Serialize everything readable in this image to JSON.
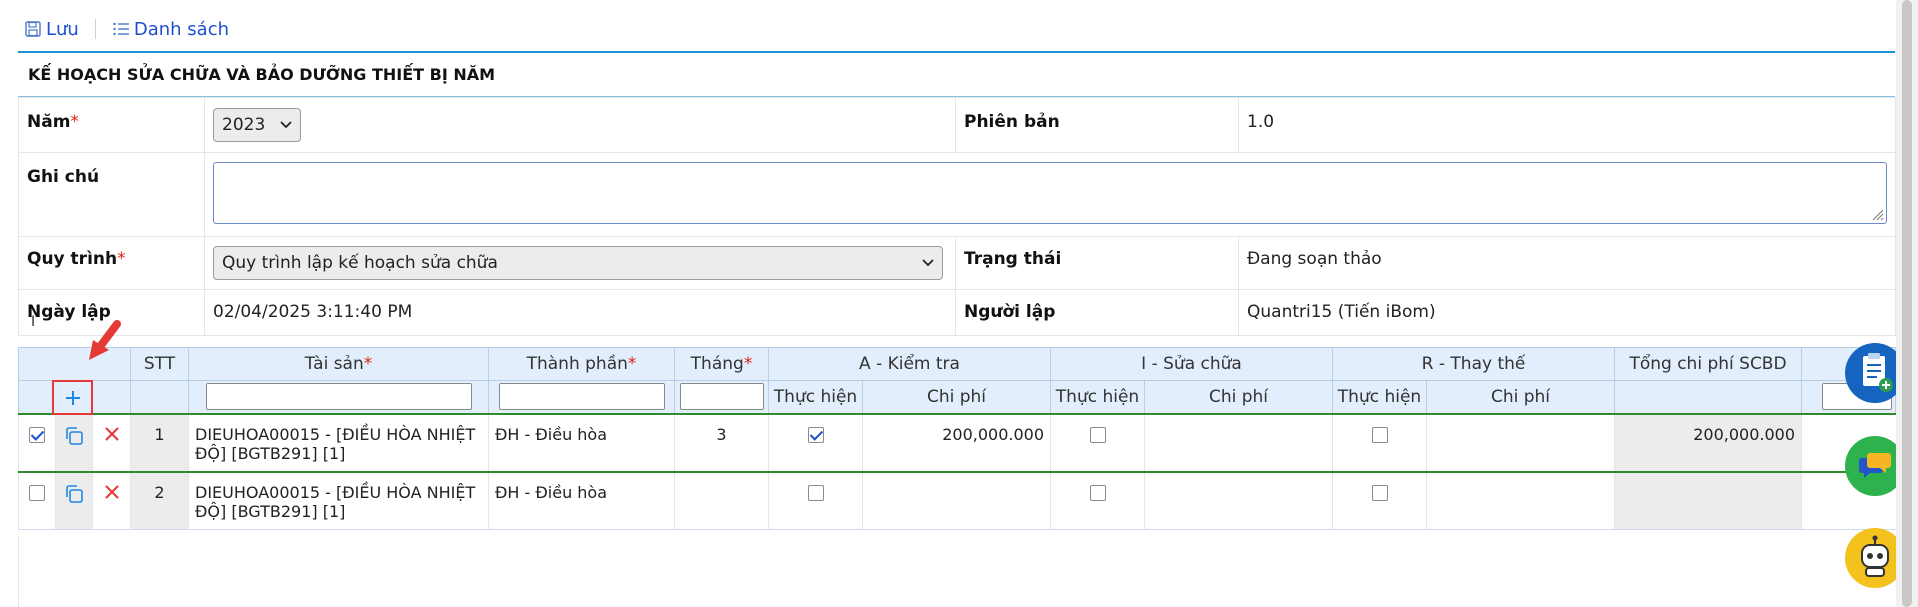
{
  "toolbar": {
    "save_label": "Lưu",
    "list_label": "Danh sách",
    "save_icon": "floppy-icon",
    "list_icon": "list-icon"
  },
  "form": {
    "title": "KẾ HOẠCH SỬA CHỮA VÀ BẢO DƯỠNG THIẾT BỊ NĂM",
    "year_label": "Năm",
    "year_value": "2023",
    "version_label": "Phiên bản",
    "version_value": "1.0",
    "note_label": "Ghi chú",
    "process_label": "Quy trình",
    "process_value": "Quy trình lập kế hoạch sửa chữa",
    "status_label": "Trạng thái",
    "status_value": "Đang soạn thảo",
    "created_date_label": "Ngày lập",
    "created_date_value": "02/04/2025 3:11:40 PM",
    "creator_label": "Người lập",
    "creator_value": "Quantri15 (Tiến iBom)",
    "required_mark": "*"
  },
  "grid": {
    "headers": {
      "stt": "STT",
      "asset": "Tài sản",
      "component": "Thành phần",
      "month": "Tháng",
      "group_a": "A - Kiểm tra",
      "group_i": "I - Sửa chữa",
      "group_r": "R - Thay thế",
      "total": "Tổng chi phí SCBD",
      "done": "Thực hiện",
      "cost": "Chi phí"
    },
    "rows": [
      {
        "stt": "1",
        "asset": "DIEUHOA00015 - [ĐIỀU HÒA NHIỆT ĐỘ] [BGTB291] [1]",
        "component": "ĐH - Điều hòa",
        "month": "3",
        "a_done": true,
        "a_cost": "200,000.000",
        "i_done": false,
        "i_cost": "",
        "r_done": false,
        "r_cost": "",
        "total": "200,000.000",
        "selected": true
      },
      {
        "stt": "2",
        "asset": "DIEUHOA00015 - [ĐIỀU HÒA NHIỆT ĐỘ] [BGTB291] [1]",
        "component": "ĐH - Điều hòa",
        "month": "",
        "a_done": false,
        "a_cost": "",
        "i_done": false,
        "i_cost": "",
        "r_done": false,
        "r_cost": "",
        "total": "",
        "selected": false
      }
    ]
  },
  "colors": {
    "accent": "#1e90d8",
    "link": "#1f4fcf",
    "header_bg": "#e2eefb",
    "selected_row_border": "#2d8a2d",
    "annotation": "#e53935",
    "delete": "#e53935"
  }
}
